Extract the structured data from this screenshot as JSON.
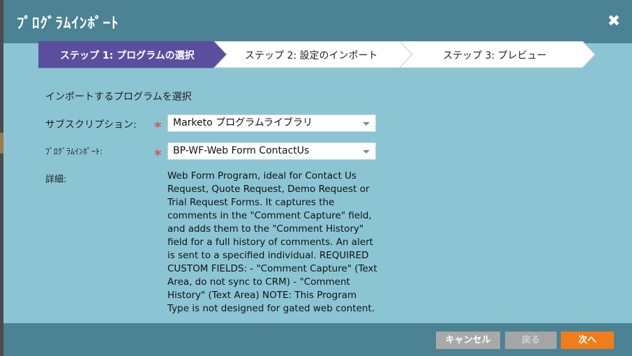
{
  "dialog": {
    "title": "ﾌﾟﾛｸﾞﾗﾑｲﾝﾎﾟｰﾄ",
    "close_icon": "close-icon"
  },
  "steps": [
    {
      "label": "ステップ 1: プログラムの選択",
      "active": true
    },
    {
      "label": "ステップ 2: 設定のインポート",
      "active": false
    },
    {
      "label": "ステップ 3: プレビュー",
      "active": false
    }
  ],
  "form": {
    "section_title": "インポートするプログラムを選択",
    "subscription_label": "サブスクリプション:",
    "subscription_value": "Marketo プログラムライブラリ",
    "program_label": "ﾌﾟﾛｸﾞﾗﾑｲﾝﾎﾟｰﾄ:",
    "program_value": "BP-WF-Web Form ContactUs",
    "details_label": "詳細:",
    "details_text": "Web Form Program, ideal for Contact Us Request, Quote Request, Demo Request or Trial Request Forms. It captures the comments in the \"Comment Capture\" field, and adds them to the \"Comment History\" field for a full history of comments. An alert is sent to a specified individual. REQUIRED CUSTOM FIELDS: - \"Comment Capture\" (Text Area, do not sync to CRM) - \"Comment History\" (Text Area) NOTE: This Program Type is not designed for gated web content.",
    "required_marker": "*"
  },
  "footer": {
    "cancel_label": "キャンセル",
    "back_label": "戻る",
    "next_label": "次へ"
  },
  "colors": {
    "titlebar": "#4b8294",
    "body": "#8bc5d4",
    "active_step": "#5a4f9e",
    "next_button": "#f07d1a",
    "required": "#d9534f"
  }
}
